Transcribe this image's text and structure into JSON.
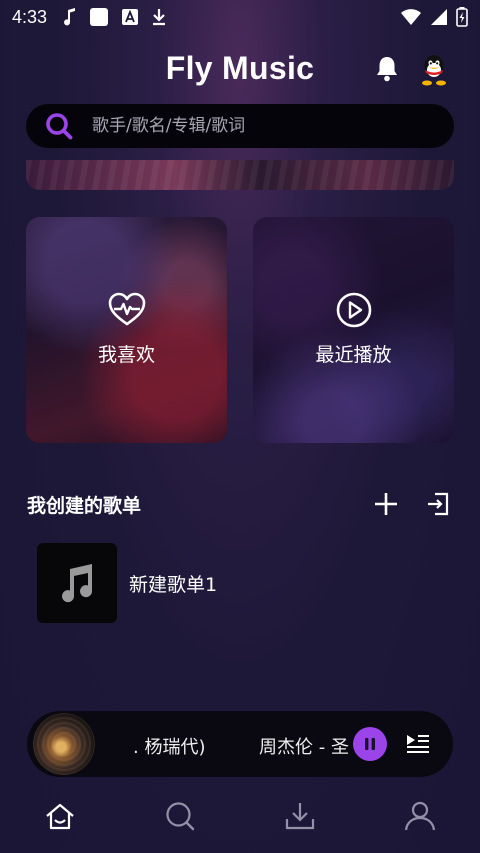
{
  "status_bar": {
    "time": "4:33",
    "left_icons": [
      "music-note-icon",
      "white-square-icon",
      "font-a-icon",
      "download-icon"
    ],
    "right_icons": [
      "wifi-icon",
      "signal-icon",
      "battery-icon"
    ]
  },
  "header": {
    "title": "Fly Music",
    "icons": [
      "bell-icon",
      "qq-avatar-icon"
    ]
  },
  "search": {
    "placeholder": "歌手/歌名/专辑/歌词"
  },
  "quick_cards": [
    {
      "label": "我喜欢",
      "icon": "heart-pulse-icon"
    },
    {
      "label": "最近播放",
      "icon": "play-circle-icon"
    }
  ],
  "playlists_section": {
    "title": "我创建的歌单",
    "actions": [
      "plus-icon",
      "import-icon"
    ],
    "items": [
      {
        "name": "新建歌单1",
        "icon": "music-note-icon"
      }
    ]
  },
  "mini_player": {
    "text_left": ". 杨瑞代)",
    "text_right": "周杰伦 - 圣",
    "state": "playing"
  },
  "tab_bar": {
    "tabs": [
      "home-icon",
      "search-icon",
      "download-icon",
      "user-icon"
    ],
    "active": 0
  },
  "colors": {
    "accent": "#9b44ea",
    "background": "#1e1838",
    "search_bg": "#05040a"
  }
}
